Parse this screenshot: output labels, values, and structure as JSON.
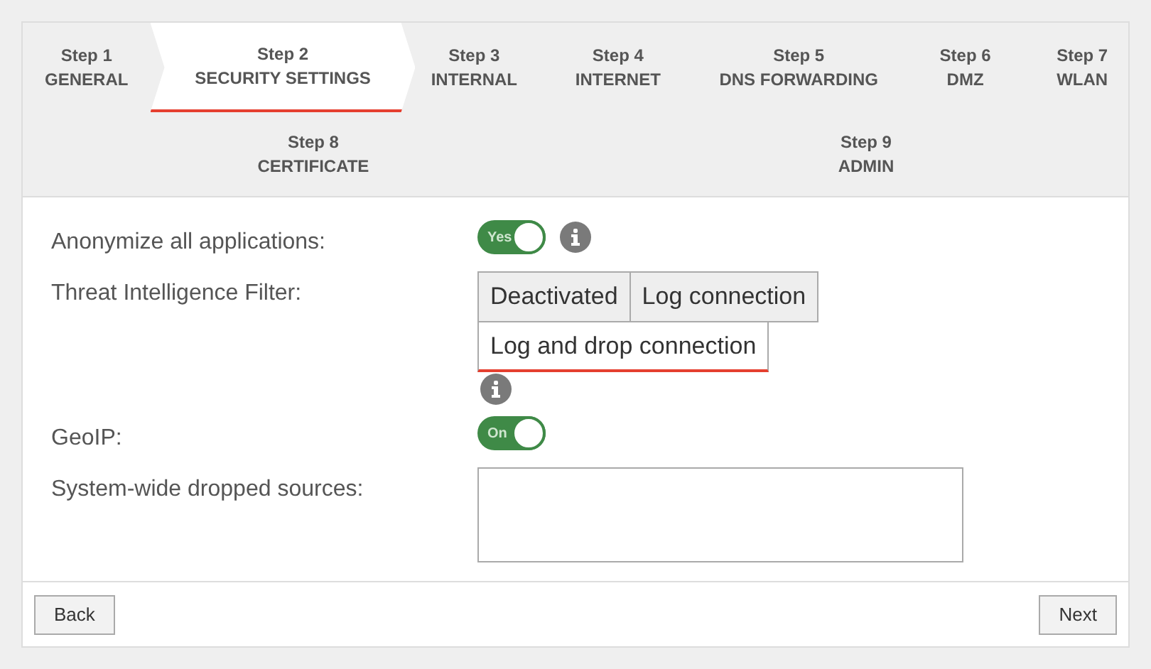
{
  "steps": [
    {
      "number": "Step 1",
      "title": "GENERAL",
      "selected": false
    },
    {
      "number": "Step 2",
      "title": "SECURITY SETTINGS",
      "selected": true
    },
    {
      "number": "Step 3",
      "title": "INTERNAL",
      "selected": false
    },
    {
      "number": "Step 4",
      "title": "INTERNET",
      "selected": false
    },
    {
      "number": "Step 5",
      "title": "DNS FORWARDING",
      "selected": false
    },
    {
      "number": "Step 6",
      "title": "DMZ",
      "selected": false
    },
    {
      "number": "Step 7",
      "title": "WLAN",
      "selected": false
    },
    {
      "number": "Step 8",
      "title": "CERTIFICATE",
      "selected": false
    },
    {
      "number": "Step 9",
      "title": "ADMIN",
      "selected": false
    }
  ],
  "form": [
    {
      "kind": "toggle",
      "label": "Anonymize all applications:",
      "on": true,
      "toggle_text": "Yes",
      "info": true
    },
    {
      "kind": "options",
      "label": "Threat Intelligence Filter:",
      "info": true,
      "options": [
        {
          "label": "Deactivated",
          "selected": false
        },
        {
          "label": "Log connection",
          "selected": false
        },
        {
          "label": "Log and drop connection",
          "selected": true
        }
      ]
    },
    {
      "kind": "toggle",
      "label": "GeoIP:",
      "on": true,
      "toggle_text": "On",
      "info": false
    },
    {
      "kind": "textarea",
      "label": "System-wide dropped sources:"
    }
  ],
  "footer": {
    "back": "Back",
    "next": "Next"
  }
}
